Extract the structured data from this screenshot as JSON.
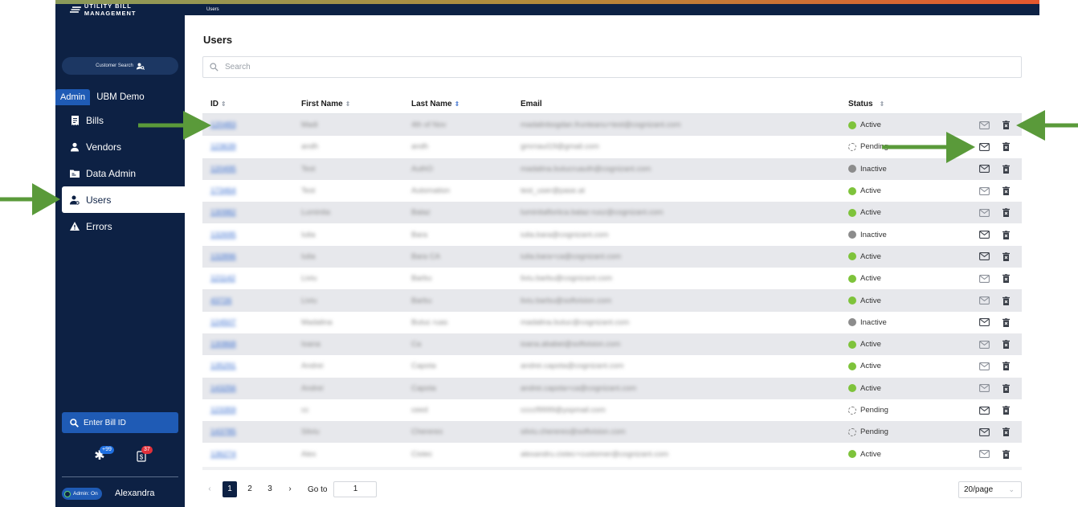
{
  "app": {
    "brand": "UTILITY BILL MANAGEMENT",
    "breadcrumb": "Users"
  },
  "sidebar": {
    "customer_search_label": "Customer Search",
    "tabs": [
      {
        "label": "Admin",
        "active": true
      },
      {
        "label": "UBM Demo",
        "active": false
      }
    ],
    "items": [
      {
        "label": "Bills",
        "icon": "bills-icon",
        "active": false
      },
      {
        "label": "Vendors",
        "icon": "vendors-icon",
        "active": false
      },
      {
        "label": "Data Admin",
        "icon": "data-admin-icon",
        "active": false
      },
      {
        "label": "Users",
        "icon": "users-icon",
        "active": true
      },
      {
        "label": "Errors",
        "icon": "errors-icon",
        "active": false
      }
    ],
    "bill_search_placeholder": "Enter Bill ID",
    "notifications": {
      "badge_1": "+99",
      "badge_2": "37"
    },
    "admin_toggle_label": "Admin: On",
    "user_name": "Alexandra"
  },
  "main": {
    "title": "Users",
    "search_placeholder": "Search",
    "columns": {
      "id": "ID",
      "first_name": "First Name",
      "last_name": "Last Name",
      "email": "Email",
      "status": "Status"
    },
    "rows": [
      {
        "id": "120483",
        "first": "Madi",
        "last": "4th of Nov",
        "email": "madalinbogdan.frunteanu+test@cognizant.com",
        "status": "Active"
      },
      {
        "id": "123639",
        "first": "andh",
        "last": "andh",
        "email": "gmrnaul19@gmail.com",
        "status": "Pending"
      },
      {
        "id": "120495",
        "first": "Test",
        "last": "AuthO",
        "email": "madalina.butucruauth@cognizant.com",
        "status": "Inactive"
      },
      {
        "id": "173464",
        "first": "Test",
        "last": "Automation",
        "email": "test_user@pase.at",
        "status": "Active"
      },
      {
        "id": "130982",
        "first": "Luminita",
        "last": "Balaz",
        "email": "luminitafloriica.balaz-rusz@cognizant.com",
        "status": "Active"
      },
      {
        "id": "132695",
        "first": "Iulia",
        "last": "Bara",
        "email": "iulia.bara@cognizant.com",
        "status": "Inactive"
      },
      {
        "id": "132896",
        "first": "Iulia",
        "last": "Bara CA",
        "email": "iulia.bara+ca@cognizant.com",
        "status": "Active"
      },
      {
        "id": "121142",
        "first": "Liviu",
        "last": "Barbu",
        "email": "liviu.barbu@cognizant.com",
        "status": "Active"
      },
      {
        "id": "43726",
        "first": "Liviu",
        "last": "Barbu",
        "email": "liviu.barbu@softvision.com",
        "status": "Active"
      },
      {
        "id": "124507",
        "first": "Madalina",
        "last": "Butuc ruas",
        "email": "madalina.butuc@cognizant.com",
        "status": "Inactive"
      },
      {
        "id": "130868",
        "first": "Ioana",
        "last": "Ca",
        "email": "ioana.ababei@softvision.com",
        "status": "Active"
      },
      {
        "id": "135291",
        "first": "Andrei",
        "last": "Capota",
        "email": "andrei.capota@cognizant.com",
        "status": "Active"
      },
      {
        "id": "143256",
        "first": "Andrei",
        "last": "Capota",
        "email": "andrei.capota+ca@cognizant.com",
        "status": "Active"
      },
      {
        "id": "123359",
        "first": "cc",
        "last": "ceed",
        "email": "ccccf9999@yopmail.com",
        "status": "Pending"
      },
      {
        "id": "143785",
        "first": "Silviu",
        "last": "Chereres",
        "email": "silviu.chereres@softvision.com",
        "status": "Pending"
      },
      {
        "id": "136274",
        "first": "Alex",
        "last": "Cistec",
        "email": "alexandru.cistec+customer@cognizant.com",
        "status": "Active"
      }
    ]
  },
  "pagination": {
    "pages": [
      "1",
      "2",
      "3"
    ],
    "current": "1",
    "goto_label": "Go to",
    "goto_value": "1",
    "page_size": "20/page"
  },
  "colors": {
    "sidebar_bg": "#0d2144",
    "accent": "#1f5bb5",
    "active_status": "#7ec33b",
    "inactive_status": "#8c8c8c",
    "arrow": "#5a9a3a"
  }
}
